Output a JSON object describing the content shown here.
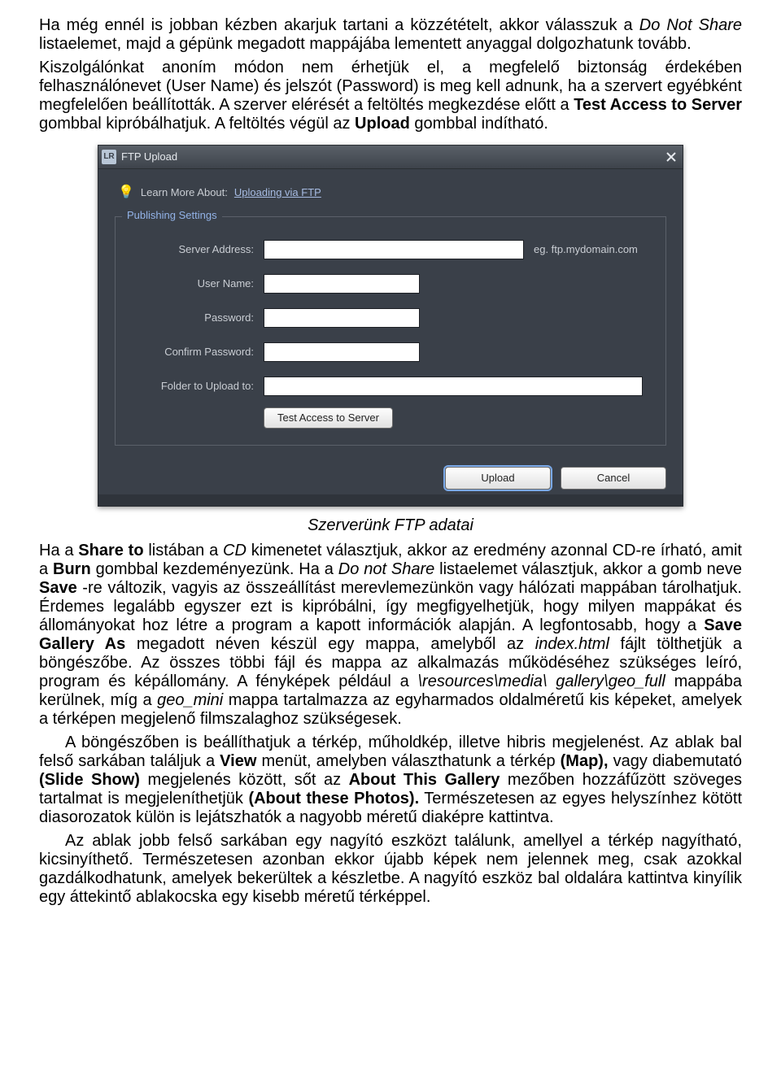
{
  "text": {
    "p1a": "Ha még ennél is jobban kézben akarjuk tartani a közzétételt, akkor válasszuk a ",
    "p1b": "Do Not Share",
    "p1c": " listaelemet, majd a gépünk megadott mappájába lementett anyaggal dolgozhatunk tovább.",
    "p2a": "Kiszolgálónkat anoním módon nem érhetjük el, a megfelelő biztonság érdekében felhasználónevet (User Name) és jelszót (Password) is meg kell adnunk, ha a szervert egyébként megfelelően beállították. A szerver elérését a feltöltés megkezdése előtt a ",
    "p2b": "Test Access to Server",
    "p2c": " gombbal kipróbálhatjuk. A feltöltés végül az ",
    "p2d": "Upload",
    "p2e": " gombbal indítható.",
    "caption": "Szerverünk FTP adatai",
    "p3a": "Ha a ",
    "p3b": "Share to",
    "p3c": " listában a ",
    "p3d": "CD",
    "p3e": " kimenetet választjuk, akkor az eredmény azonnal CD-re írható, amit a ",
    "p3f": "Burn",
    "p3g": " gombbal kezdeményezünk. Ha a ",
    "p3h": "Do not Share",
    "p3i": " listaelemet választjuk, akkor a gomb neve ",
    "p3j": "Save",
    "p3k": "-re változik, vagyis az összeállítást merevlemezünkön vagy hálózati mappában tárolhatjuk. Érdemes legalább egyszer ezt is kipróbálni, így megfigyelhetjük, hogy milyen mappákat és állományokat hoz létre a program a kapott információk alapján. A legfontosabb, hogy a ",
    "p3l": "Save Gallery As",
    "p3m": "  megadott néven készül egy mappa, amelyből az ",
    "p3n": "index.html",
    "p3o": " fájlt tölthetjük a böngészőbe. Az összes többi fájl és mappa az alkalmazás működéséhez szükséges leíró, program és képállomány. A fényképek például a ",
    "p3p": "\\resources\\media\\ gallery\\geo_full",
    "p3q": " mappába kerülnek, míg a ",
    "p3r": "geo_mini",
    "p3s": " mappa tartalmazza az egyharmados oldalméretű kis képeket, amelyek a térképen megjelenő filmszalaghoz szükségesek.",
    "p4a": "A böngészőben is beállíthatjuk a térkép, műholdkép, illetve hibris megjelenést. Az ablak bal felső sarkában találjuk a ",
    "p4b": "View",
    "p4c": " menüt, amelyben választhatunk a térkép ",
    "p4d": "(Map),",
    "p4e": " vagy diabemutató ",
    "p4f": "(Slide Show)",
    "p4g": " megjelenés között, sőt az ",
    "p4h": "About This Gallery",
    "p4i": " mezőben hozzáfűzött szöveges tartalmat is megjeleníthetjük ",
    "p4j": "(About these Photos).",
    "p4k": " Természetesen az egyes helyszínhez kötött diasorozatok külön is lejátszhatók a nagyobb méretű diaképre kattintva.",
    "p5": "Az ablak jobb felső sarkában egy nagyító eszközt találunk, amellyel a térkép nagyítható, kicsinyíthető. Természetesen azonban ekkor újabb képek nem jelennek meg, csak azokkal gazdálkodhatunk, amelyek bekerültek a készletbe. A nagyító eszköz bal oldalára kattintva kinyílik egy áttekintő ablakocska egy kisebb méretű térképpel."
  },
  "dialog": {
    "title": "FTP Upload",
    "appIcon": "LR",
    "learnMore": {
      "label": "Learn More About:",
      "link": "Uploading via FTP"
    },
    "legend": "Publishing Settings",
    "labels": {
      "server": "Server Address:",
      "user": "User Name:",
      "password": "Password:",
      "confirm": "Confirm Password:",
      "folder": "Folder to Upload to:"
    },
    "eg": "eg. ftp.mydomain.com",
    "buttons": {
      "test": "Test Access to Server",
      "upload": "Upload",
      "cancel": "Cancel"
    }
  }
}
